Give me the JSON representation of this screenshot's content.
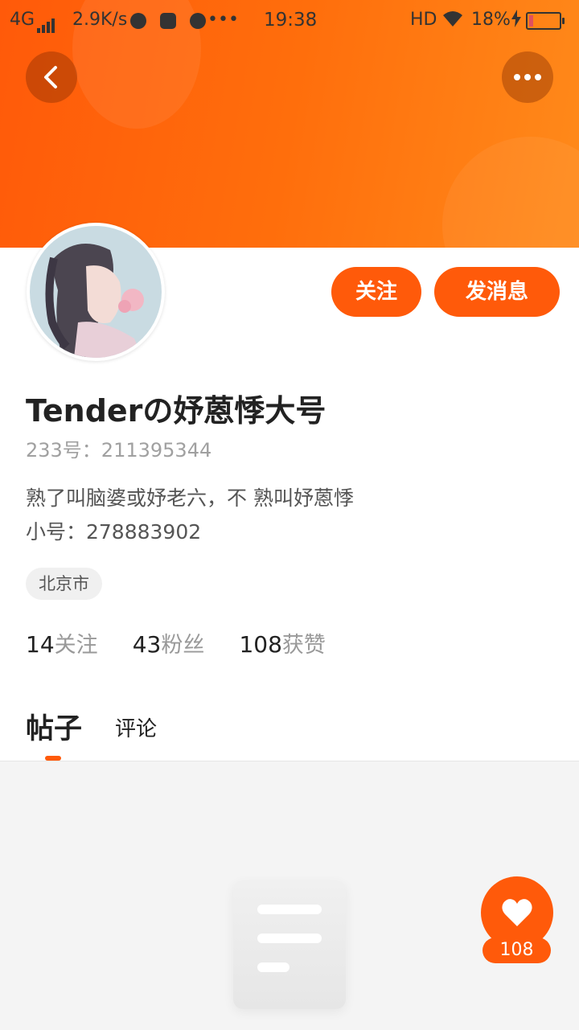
{
  "status_bar": {
    "network": "4G",
    "speed": "2.9K/s",
    "more": "•••",
    "time": "19:38",
    "hd": "HD",
    "battery": "18%"
  },
  "profile": {
    "name": "Tenderの妤蒽悸大号",
    "id_text": "233号：211395344",
    "bio_line1": "熟了叫脑婆或妤老六，不 熟叫妤蒽悸",
    "bio_line2": "小号：278883902",
    "location": "北京市"
  },
  "actions": {
    "follow": "关注",
    "message": "发消息"
  },
  "stats": {
    "following_num": "14",
    "following_label": "关注",
    "fans_num": "43",
    "fans_label": "粉丝",
    "likes_num": "108",
    "likes_label": "获赞"
  },
  "tabs": {
    "posts": "帖子",
    "comments": "评论",
    "active": "posts"
  },
  "like_fab": {
    "count": "108"
  },
  "colors": {
    "accent": "#ff5a0a"
  }
}
